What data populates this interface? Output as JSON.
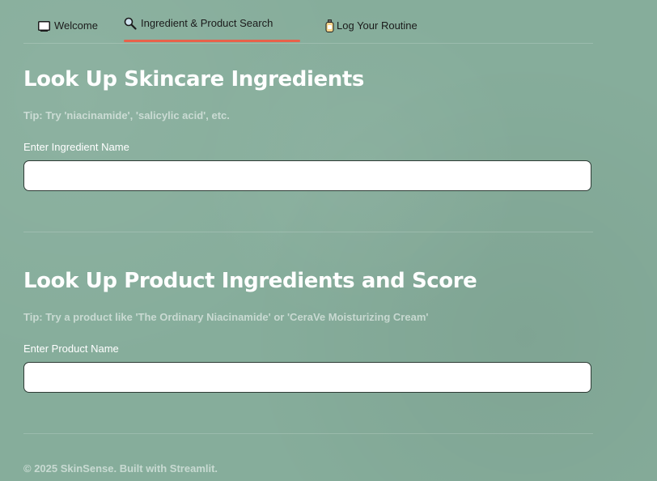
{
  "tabs": [
    {
      "label": "Welcome",
      "icon": "monitor-icon"
    },
    {
      "label": "Ingredient & Product Search",
      "icon": "magnifier-icon"
    },
    {
      "label": "Log Your Routine",
      "icon": "bottle-icon"
    }
  ],
  "active_tab_color": "#e8614a",
  "ingredient_section": {
    "title": "Look Up Skincare Ingredients",
    "tip": "Tip: Try 'niacinamide', 'salicylic acid', etc.",
    "field_label": "Enter Ingredient Name",
    "value": "",
    "placeholder": ""
  },
  "product_section": {
    "title": "Look Up Product Ingredients and Score",
    "tip": "Tip: Try a product like 'The Ordinary Niacinamide' or 'CeraVe Moisturizing Cream'",
    "field_label": "Enter Product Name",
    "value": "",
    "placeholder": ""
  },
  "footer": {
    "text": "© 2025 SkinSense. Built with Streamlit."
  }
}
